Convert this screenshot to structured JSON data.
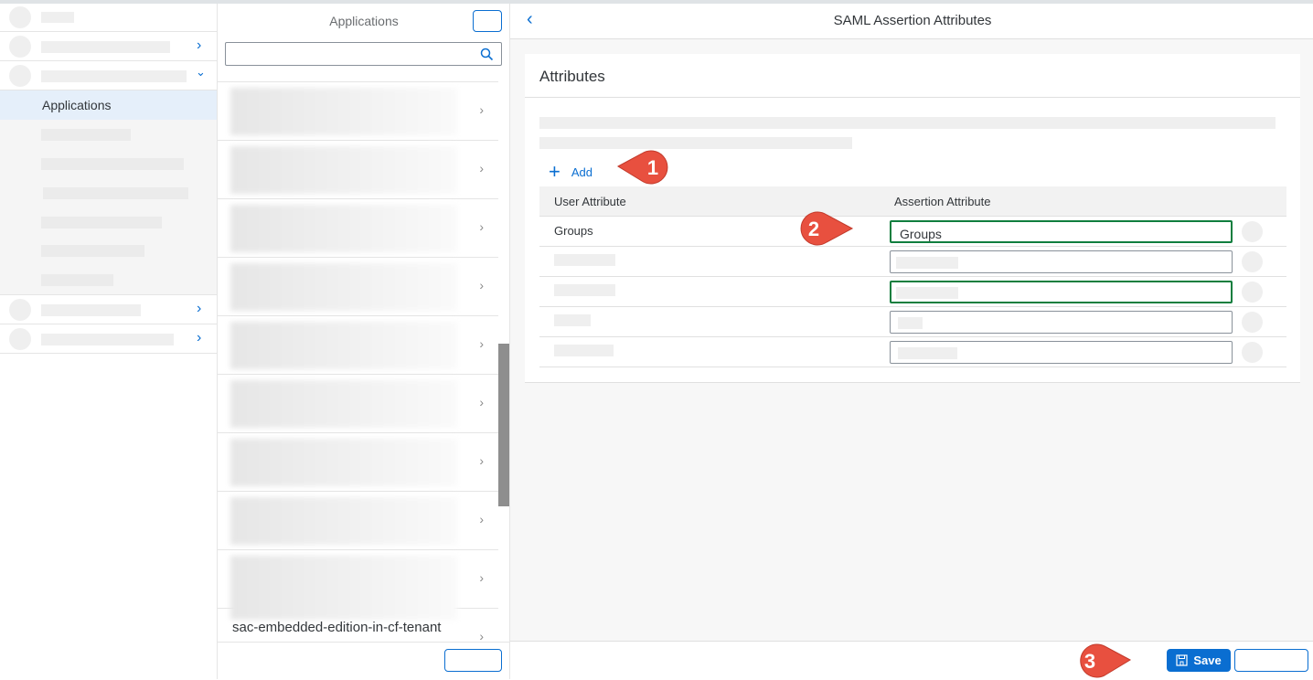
{
  "sidebar": {
    "selected_item": "Applications"
  },
  "middle": {
    "title": "Applications",
    "search_placeholder": "",
    "last_item": "sac-embedded-edition-in-cf-tenant"
  },
  "detail": {
    "title": "SAML Assertion Attributes",
    "section_title": "Attributes",
    "add_label": "Add",
    "columns": [
      "User Attribute",
      "Assertion Attribute"
    ],
    "rows": [
      {
        "user_attribute": "Groups",
        "assertion_attribute": "Groups"
      }
    ]
  },
  "footer": {
    "save_label": "Save"
  },
  "callouts": [
    "1",
    "2",
    "3"
  ],
  "colors": {
    "accent": "#0a6ed1",
    "valid_border": "#107e3e",
    "callout": "#e8503f",
    "selected_bg": "#e5effa"
  }
}
